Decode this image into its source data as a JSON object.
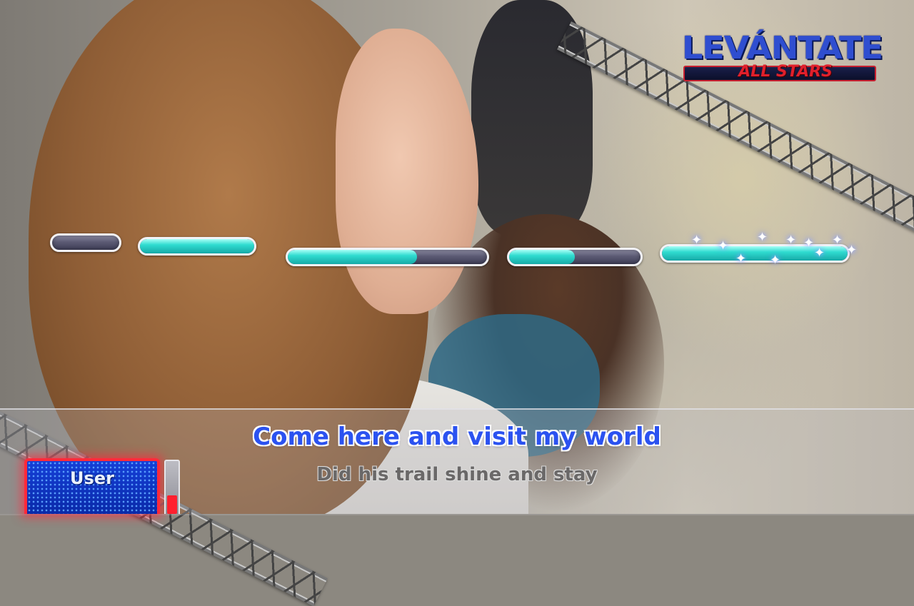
{
  "logo": {
    "main": "LEVÁNTATE",
    "sub": "ALL STARS"
  },
  "note_bars": [
    {
      "id": 1,
      "progress": 0.0
    },
    {
      "id": 2,
      "progress": 1.0
    },
    {
      "id": 3,
      "progress": 0.65
    },
    {
      "id": 4,
      "progress": 0.5
    },
    {
      "id": 5,
      "progress": 1.0,
      "sparkles": true
    }
  ],
  "lyrics": {
    "current": "Come here and visit my world",
    "next": "Did his trail shine and stay"
  },
  "player": {
    "name": "User",
    "score_level": 0.35
  },
  "colors": {
    "note_fill": "#2fdcd0",
    "lyric_current": "#2b52f0",
    "player_border": "#ff2a3a"
  }
}
